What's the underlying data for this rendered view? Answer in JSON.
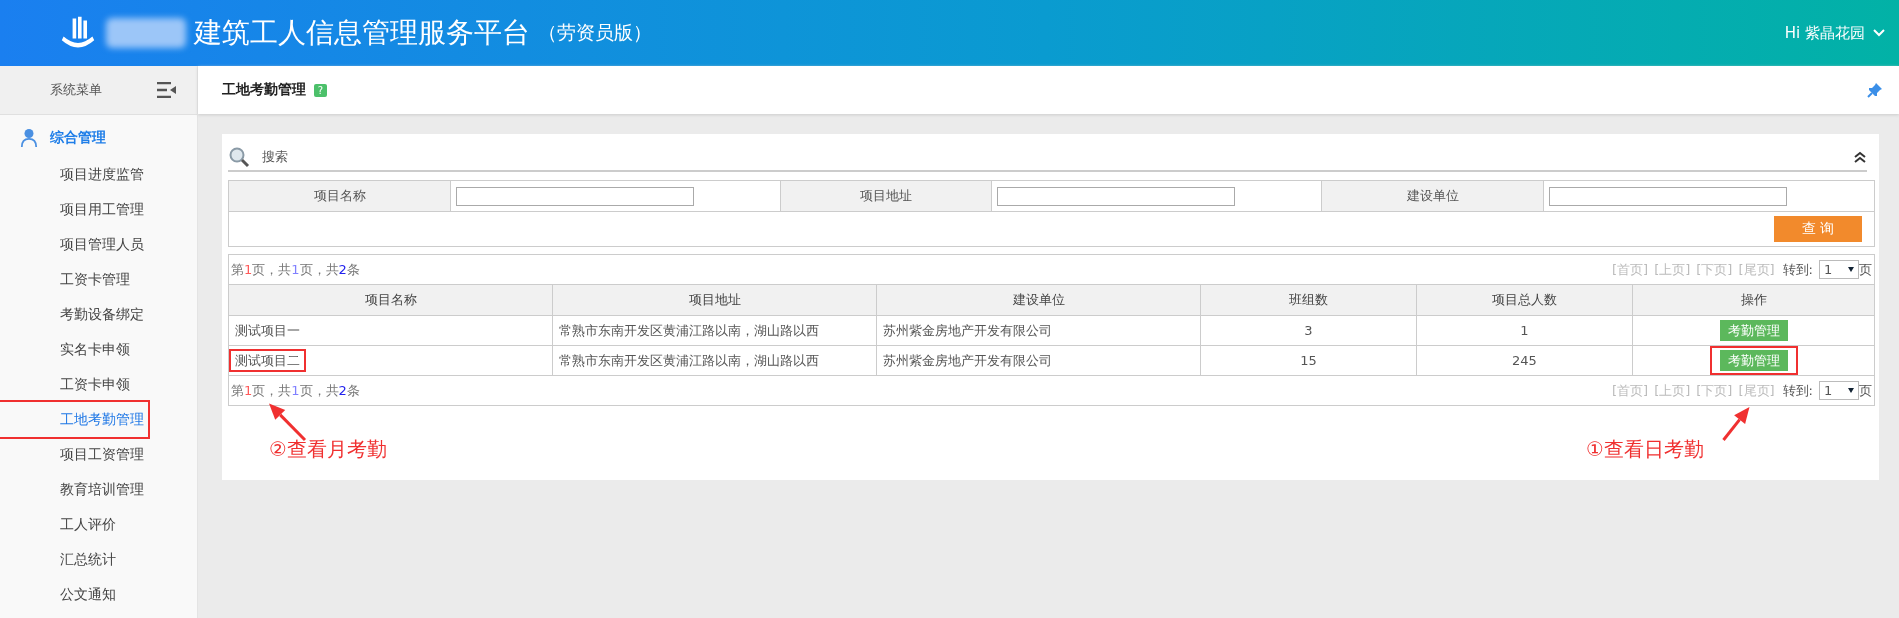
{
  "header": {
    "title": "建筑工人信息管理服务平台",
    "subtitle": "（劳资员版）",
    "user": "Hi 紫晶花园"
  },
  "sidebar": {
    "title": "系统菜单",
    "groups": [
      {
        "label": "综合管理",
        "expanded": true,
        "children": [
          {
            "label": "项目进度监管",
            "selected": false,
            "boxed": false
          },
          {
            "label": "项目用工管理",
            "selected": false,
            "boxed": false
          },
          {
            "label": "项目管理人员",
            "selected": false,
            "boxed": false
          },
          {
            "label": "工资卡管理",
            "selected": false,
            "boxed": false
          },
          {
            "label": "考勤设备绑定",
            "selected": false,
            "boxed": false
          },
          {
            "label": "实名卡申领",
            "selected": false,
            "boxed": false
          },
          {
            "label": "工资卡申领",
            "selected": false,
            "boxed": false
          },
          {
            "label": "工地考勤管理",
            "selected": true,
            "boxed": true
          },
          {
            "label": "项目工资管理",
            "selected": false,
            "boxed": false
          },
          {
            "label": "教育培训管理",
            "selected": false,
            "boxed": false
          },
          {
            "label": "工人评价",
            "selected": false,
            "boxed": false
          },
          {
            "label": "汇总统计",
            "selected": false,
            "boxed": false
          },
          {
            "label": "公文通知",
            "selected": false,
            "boxed": false
          }
        ]
      }
    ]
  },
  "page": {
    "title": "工地考勤管理",
    "help": "?"
  },
  "search": {
    "title": "搜索",
    "fields": [
      {
        "label": "项目名称"
      },
      {
        "label": "项目地址"
      },
      {
        "label": "建设单位"
      }
    ],
    "button": "查 询"
  },
  "pager_top": {
    "summary": [
      {
        "text": "第"
      },
      {
        "text": "1",
        "color": "#ff5a5a"
      },
      {
        "text": "页，共"
      },
      {
        "text": "1",
        "color": "#8080ff"
      },
      {
        "text": "页，共"
      },
      {
        "text": "2",
        "color": "#2222ee"
      },
      {
        "text": "条"
      }
    ],
    "links": [
      {
        "label": "[首页]",
        "disabled": true
      },
      {
        "label": "[上页]",
        "disabled": true
      },
      {
        "label": "[下页]",
        "disabled": true
      },
      {
        "label": "[尾页]",
        "disabled": true
      }
    ],
    "goto": "转到:",
    "page": "1",
    "unit": "页"
  },
  "table": {
    "columns": [
      "项目名称",
      "项目地址",
      "建设单位",
      "班组数",
      "项目总人数",
      "操作"
    ],
    "rows": [
      {
        "cells": [
          "测试项目一",
          "常熟市东南开发区黄浦江路以南，湖山路以西",
          "苏州紫金房地产开发有限公司",
          "3",
          "1"
        ],
        "action": "考勤管理"
      },
      {
        "cells": [
          "测试项目二",
          "常熟市东南开发区黄浦江路以南，湖山路以西",
          "苏州紫金房地产开发有限公司",
          "15",
          "245"
        ],
        "action": "考勤管理",
        "name_note": "②查看月考勤",
        "action_note": "①查看日考勤"
      }
    ]
  },
  "pager_bottom": {
    "summary": [
      {
        "text": "第"
      },
      {
        "text": "1",
        "color": "#ff5a5a"
      },
      {
        "text": "页，共"
      },
      {
        "text": "1",
        "color": "#8080ff"
      },
      {
        "text": "页，共"
      },
      {
        "text": "2",
        "color": "#2222ee"
      },
      {
        "text": "条"
      }
    ],
    "links": [
      {
        "label": "[首页]",
        "disabled": true
      },
      {
        "label": "[上页]",
        "disabled": true
      },
      {
        "label": "[下页]",
        "disabled": true
      },
      {
        "label": "[尾页]",
        "disabled": true
      }
    ],
    "goto": "转到:",
    "page": "1",
    "unit": "页"
  }
}
